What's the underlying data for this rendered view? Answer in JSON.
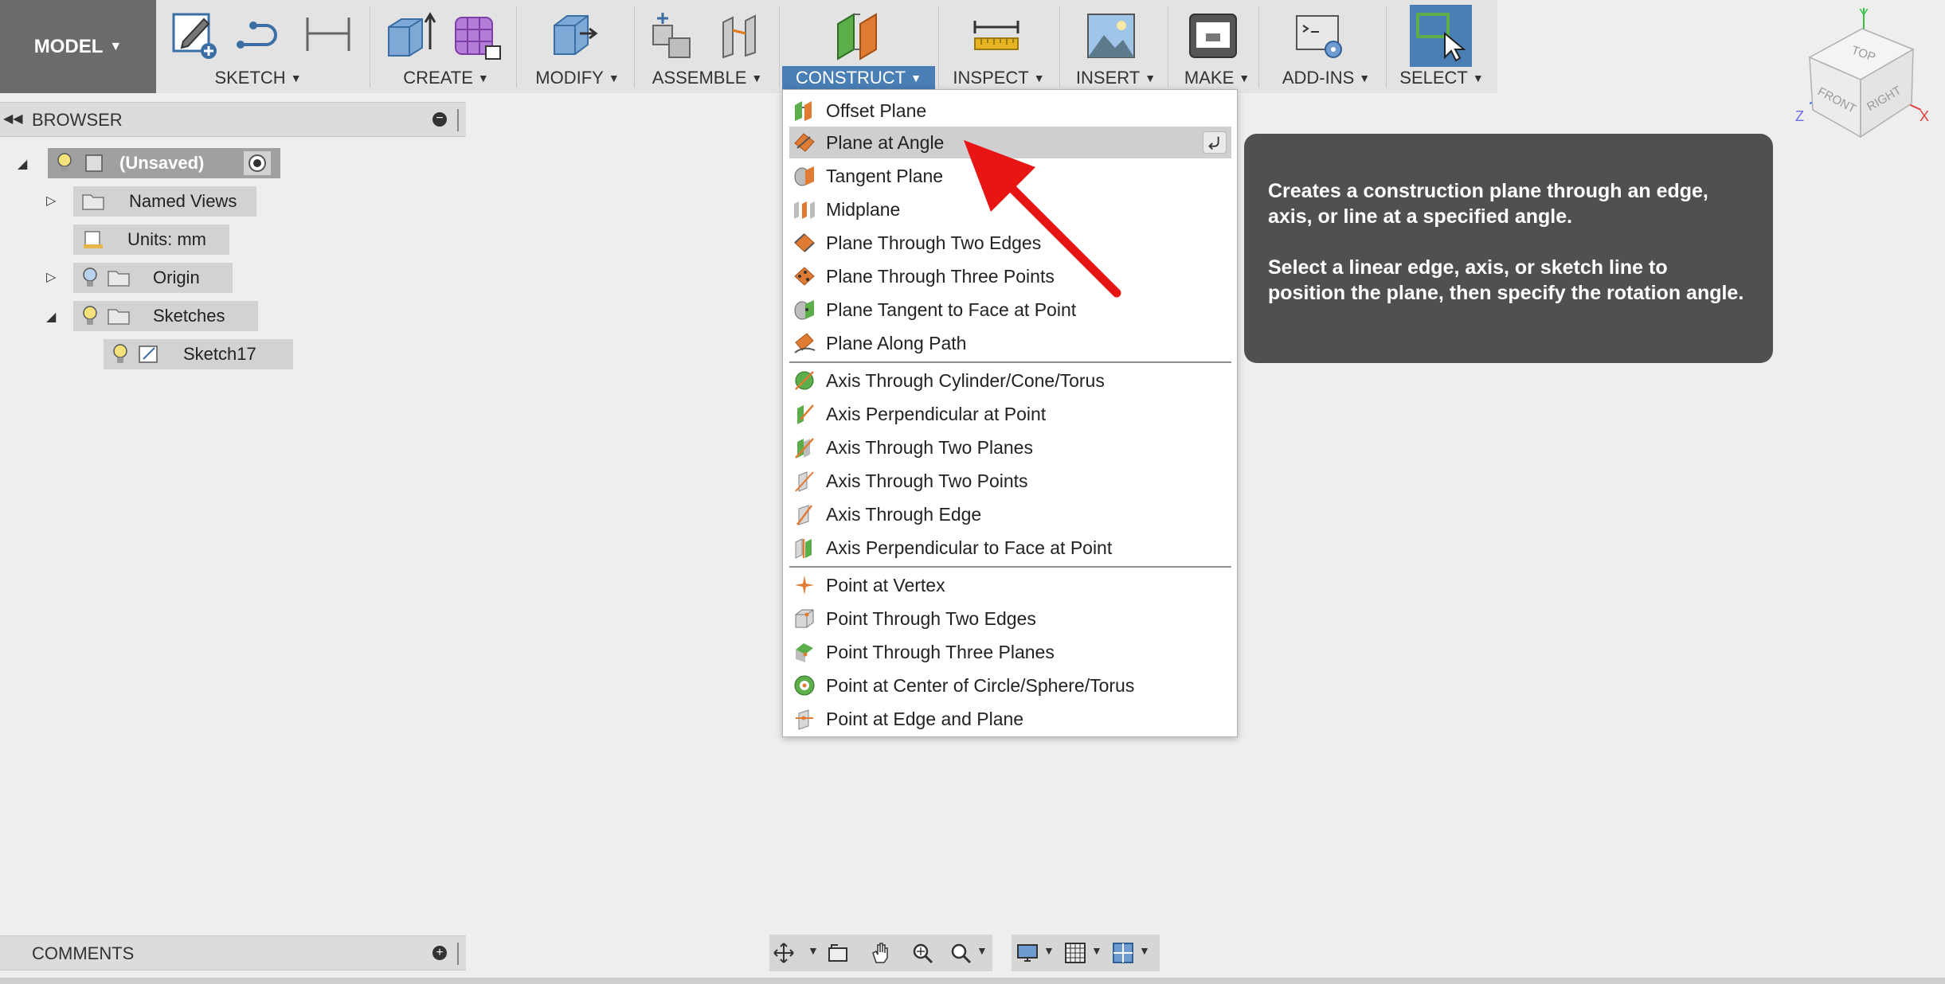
{
  "toolbar": {
    "workspace": "MODEL",
    "groups": {
      "sketch": "SKETCH",
      "create": "CREATE",
      "modify": "MODIFY",
      "assemble": "ASSEMBLE",
      "construct": "CONSTRUCT",
      "inspect": "INSPECT",
      "insert": "INSERT",
      "make": "MAKE",
      "addins": "ADD-INS",
      "select": "SELECT"
    }
  },
  "browser": {
    "title": "BROWSER",
    "root": "(Unsaved)",
    "items": [
      {
        "label": "Named Views"
      },
      {
        "label": "Units: mm"
      },
      {
        "label": "Origin"
      },
      {
        "label": "Sketches"
      },
      {
        "label": "Sketch17"
      }
    ]
  },
  "comments": {
    "title": "COMMENTS"
  },
  "construct_menu": {
    "items": [
      {
        "label": "Offset Plane",
        "icon": "offset-plane-icon"
      },
      {
        "label": "Plane at Angle",
        "icon": "plane-at-angle-icon",
        "highlighted": true
      },
      {
        "label": "Tangent Plane",
        "icon": "tangent-plane-icon"
      },
      {
        "label": "Midplane",
        "icon": "midplane-icon"
      },
      {
        "label": "Plane Through Two Edges",
        "icon": "plane-two-edges-icon"
      },
      {
        "label": "Plane Through Three Points",
        "icon": "plane-three-points-icon"
      },
      {
        "label": "Plane Tangent to Face at Point",
        "icon": "plane-tangent-face-icon"
      },
      {
        "label": "Plane Along Path",
        "icon": "plane-along-path-icon"
      },
      {
        "label": "Axis Through Cylinder/Cone/Torus",
        "icon": "axis-cylinder-icon"
      },
      {
        "label": "Axis Perpendicular at Point",
        "icon": "axis-perpendicular-icon"
      },
      {
        "label": "Axis Through Two Planes",
        "icon": "axis-two-planes-icon"
      },
      {
        "label": "Axis Through Two Points",
        "icon": "axis-two-points-icon"
      },
      {
        "label": "Axis Through Edge",
        "icon": "axis-edge-icon"
      },
      {
        "label": "Axis Perpendicular to Face at Point",
        "icon": "axis-perp-face-icon"
      },
      {
        "label": "Point at Vertex",
        "icon": "point-vertex-icon"
      },
      {
        "label": "Point Through Two Edges",
        "icon": "point-two-edges-icon"
      },
      {
        "label": "Point Through Three Planes",
        "icon": "point-three-planes-icon"
      },
      {
        "label": "Point at Center of Circle/Sphere/Torus",
        "icon": "point-center-icon"
      },
      {
        "label": "Point at Edge and Plane",
        "icon": "point-edge-plane-icon"
      }
    ]
  },
  "tooltip": {
    "line1": "Creates a construction plane through an edge, axis, or line at a specified angle.",
    "line2": "Select a linear edge, axis, or sketch line to position the plane, then specify the rotation angle."
  },
  "viewcube": {
    "top": "TOP",
    "front": "FRONT",
    "right": "RIGHT",
    "x": "X",
    "y": "Y",
    "z": "Z"
  },
  "colors": {
    "accent": "#4a7fb5",
    "tooltip_bg": "#505050",
    "arrow": "#e81515"
  }
}
